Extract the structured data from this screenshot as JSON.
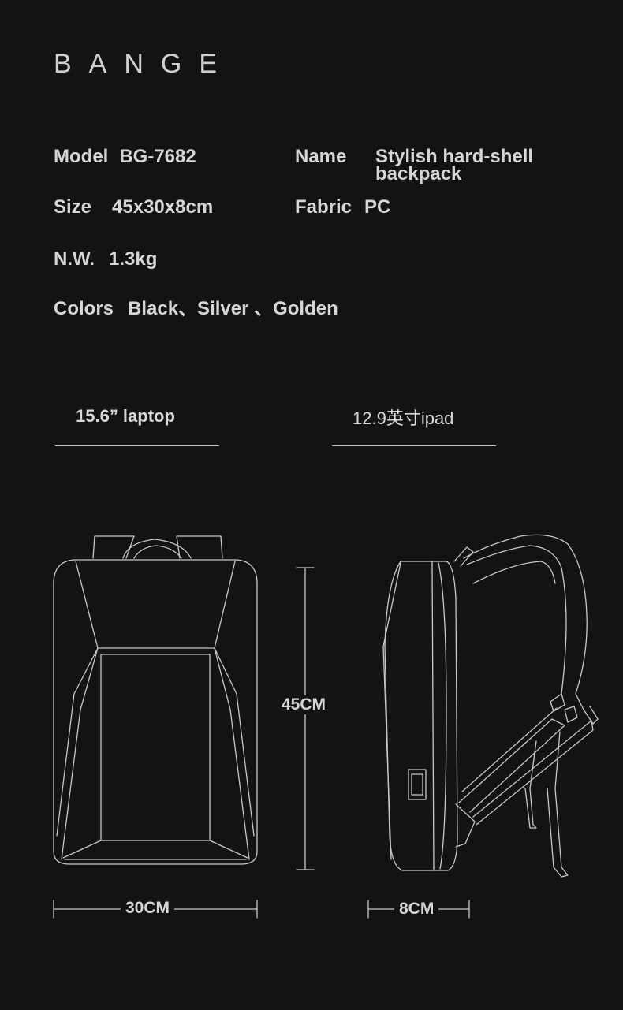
{
  "brand": "BANGE",
  "specs": {
    "model": {
      "label": "Model",
      "value": "BG-7682"
    },
    "name": {
      "label": "Name",
      "value": "Stylish hard-shell backpack"
    },
    "size": {
      "label": "Size",
      "value": "45x30x8cm"
    },
    "fabric": {
      "label": "Fabric",
      "value": "PC"
    },
    "nw": {
      "label": "N.W.",
      "value": "1.3kg"
    },
    "colors": {
      "label": "Colors",
      "value": "Black、Silver 、Golden"
    }
  },
  "captions": {
    "laptop": "15.6” laptop",
    "ipad": "12.9英寸ipad"
  },
  "dimensions": {
    "height": "45CM",
    "width": "30CM",
    "depth": "8CM"
  },
  "colors": {
    "background": "#131313",
    "text": "#d6d6d6",
    "line": "#c8c8c8"
  }
}
